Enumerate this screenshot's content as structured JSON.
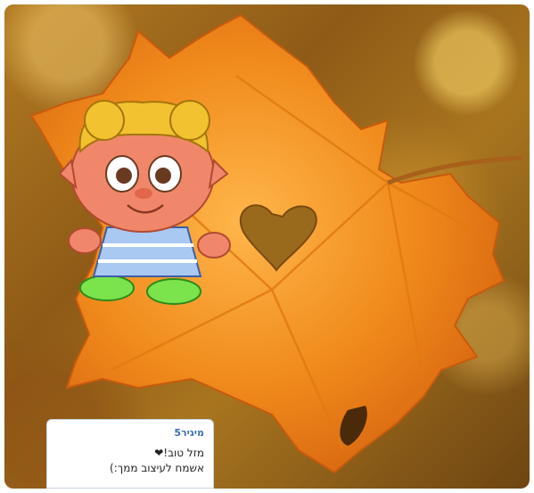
{
  "image": {
    "description_icon": "autumn-maple-leaf-with-heart-cutout",
    "character_icon": "cartoon-girl-character"
  },
  "comment": {
    "author": "מיגיר5",
    "line1": "מזל טוב!❤",
    "line2": "אשמח לעיצוב ממך:)"
  },
  "colors": {
    "author_link": "#3b6fb0",
    "leaf": "#f08a1c",
    "background": "#9a6a1c"
  }
}
